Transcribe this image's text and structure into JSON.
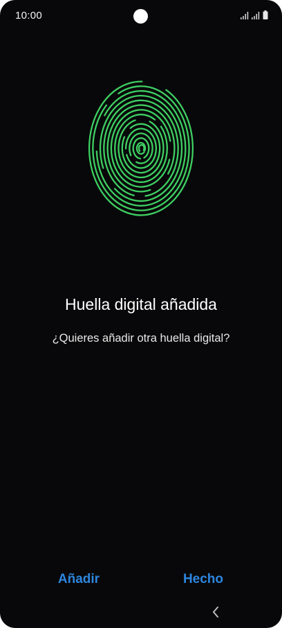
{
  "status_bar": {
    "time": "10:00",
    "icons": [
      "signal-icon",
      "signal-icon",
      "battery-icon"
    ]
  },
  "fingerprint": {
    "icon": "fingerprint-icon",
    "color": "#3fcf62"
  },
  "main": {
    "title": "Huella digital añadida",
    "subtitle": "¿Quieres añadir otra huella digital?"
  },
  "actions": {
    "add_label": "Añadir",
    "done_label": "Hecho",
    "accent": "#2e86de"
  },
  "nav": {
    "back_icon": "chevron-left-icon"
  }
}
